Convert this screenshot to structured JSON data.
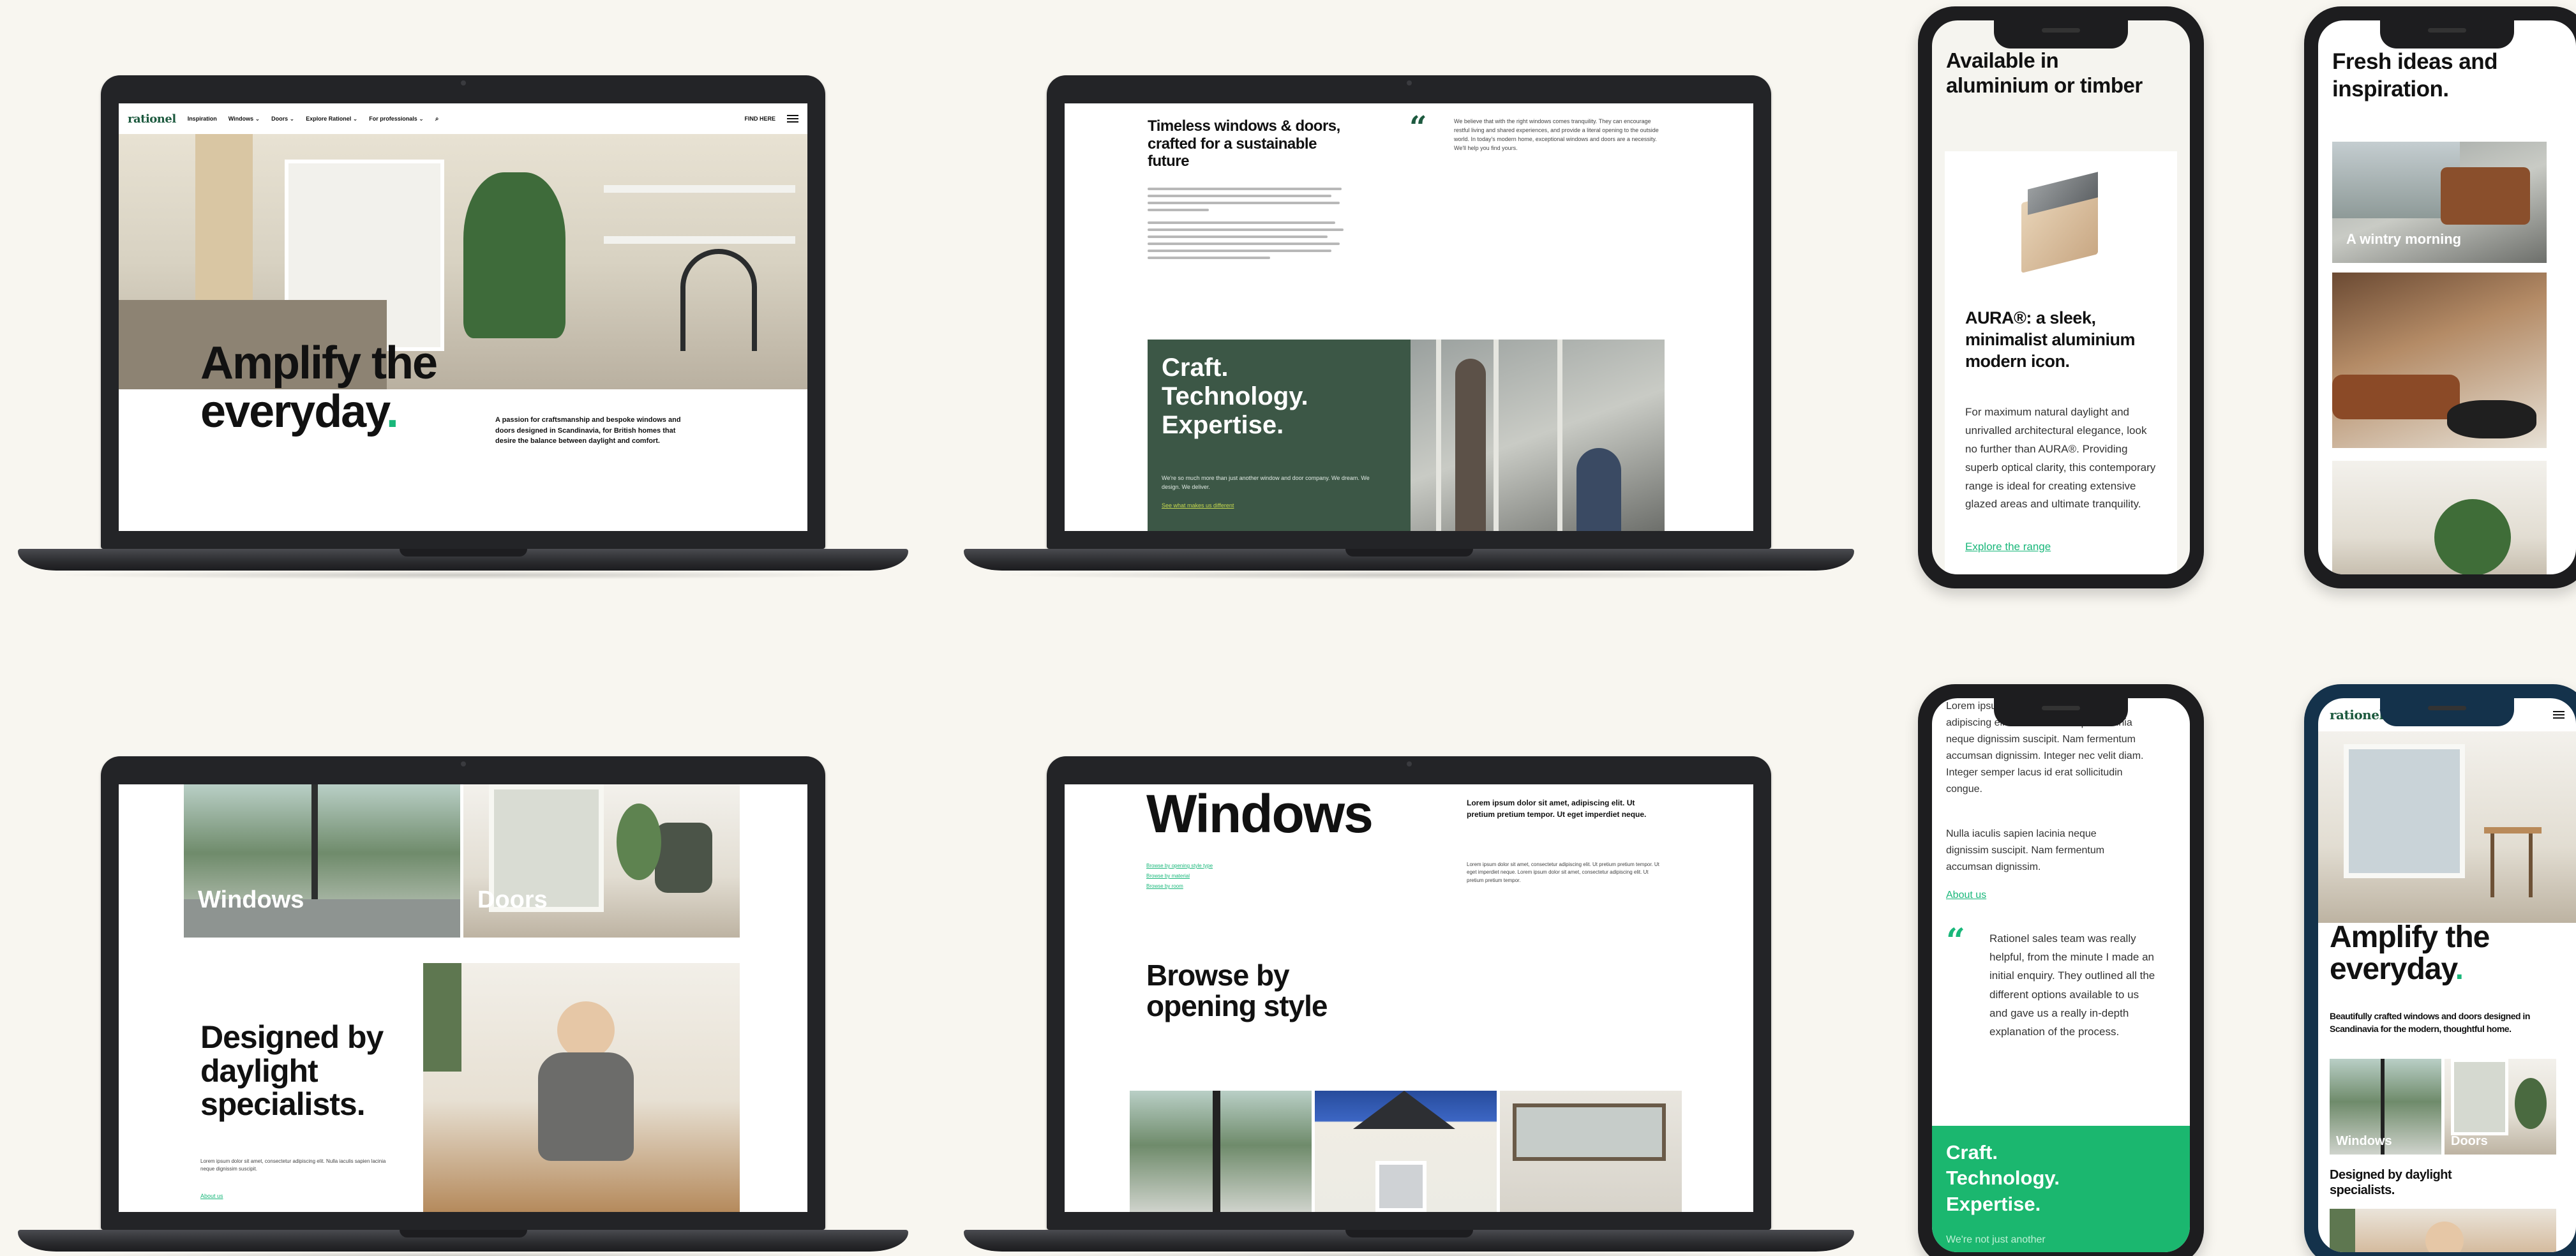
{
  "laptop1": {
    "logo": "rationel",
    "nav": [
      "Inspiration",
      "Windows ⌄",
      "Doors ⌄",
      "Explore Rationel ⌄",
      "For professionals ⌄"
    ],
    "nav_right": "FIND HERE",
    "hero_title_1": "Amplify the",
    "hero_title_2": "everyday",
    "hero_dot": ".",
    "hero_body": "A passion for craftsmanship and bespoke windows and doors designed in Scandinavia, for British homes that desire the balance between daylight and comfort."
  },
  "laptop2": {
    "heading": "Timeless windows & doors, crafted for a sustainable future",
    "quote": "We believe that with the right windows comes tranquility. They can encourage restful living and shared experiences, and provide a literal opening to the outside world. In today's modern home, exceptional windows and doors are a necessity. We'll help you find yours.",
    "banner_title_1": "Craft.",
    "banner_title_2": "Technology.",
    "banner_title_3": "Expertise.",
    "banner_body": "We're so much more than just another window and door company. We dream. We design. We deliver.",
    "banner_link": "See what makes us different"
  },
  "laptop3": {
    "tile1": "Windows",
    "tile2": "Doors",
    "title_1": "Designed by",
    "title_2": "daylight",
    "title_3": "specialists.",
    "body": "Lorem ipsum dolor sit amet, consectetur adipiscing elit. Nulla iaculis sapien lacinia neque dignissim suscipit.",
    "link": "About us"
  },
  "laptop4": {
    "title": "Windows",
    "links": [
      "Browse by opening style type",
      "Browse by material",
      "Browse by room"
    ],
    "intro_bold": "Lorem ipsum dolor sit amet, adipiscing elit. Ut pretium pretium tempor. Ut eget imperdiet neque.",
    "intro_body": "Lorem ipsum dolor sit amet, consectetur adipiscing elit. Ut pretium pretium tempor. Ut eget imperdiet neque. Lorem ipsum dolor sit amet, consectetur adipiscing elit. Ut pretium pretium tempor.",
    "section_1": "Browse by",
    "section_2": "opening style"
  },
  "phone1": {
    "title": "Available in aluminium or timber",
    "product_title": "AURA®: a sleek, minimalist aluminium modern icon.",
    "product_body": "For maximum natural daylight and unrivalled architectural elegance, look no further than AURA®. Providing superb optical clarity, this contemporary range is ideal for creating extensive glazed areas and ultimate tranquility.",
    "link": "Explore the range"
  },
  "phone2": {
    "title": "Fresh ideas and inspiration.",
    "caption": "A wintry morning"
  },
  "phone3": {
    "top_text": "Lorem ipsum dolor sit amet, consectetur adipiscing elit. Nulla iaculis sapien lacinia neque dignissim suscipit. Nam fermentum accumsan dignissim. Integer nec velit diam. Integer semper lacus id erat sollicitudin congue.",
    "para2": "Nulla iaculis sapien lacinia neque dignissim suscipit. Nam fermentum accumsan dignissim.",
    "link": "About us",
    "quote": "Rationel sales team was really helpful, from the minute I made an initial enquiry. They outlined all the different options available to us and gave us a really in-depth explanation of the process.",
    "banner_1": "Craft.",
    "banner_2": "Technology.",
    "banner_3": "Expertise.",
    "banner_body": "We're not just another"
  },
  "phone4": {
    "logo": "rationel",
    "title_1": "Amplify the",
    "title_2": "everyday",
    "dot": ".",
    "body": "Beautifully crafted windows and doors designed in Scandinavia for the modern, thoughtful home.",
    "tile1": "Windows",
    "tile2": "Doors",
    "subtitle": "Designed by daylight specialists."
  },
  "colors": {
    "brand_green": "#1d5a3f",
    "accent_green": "#19b77a",
    "dark_green_panel": "#3c5746",
    "bright_green_panel": "#1bb76f"
  }
}
